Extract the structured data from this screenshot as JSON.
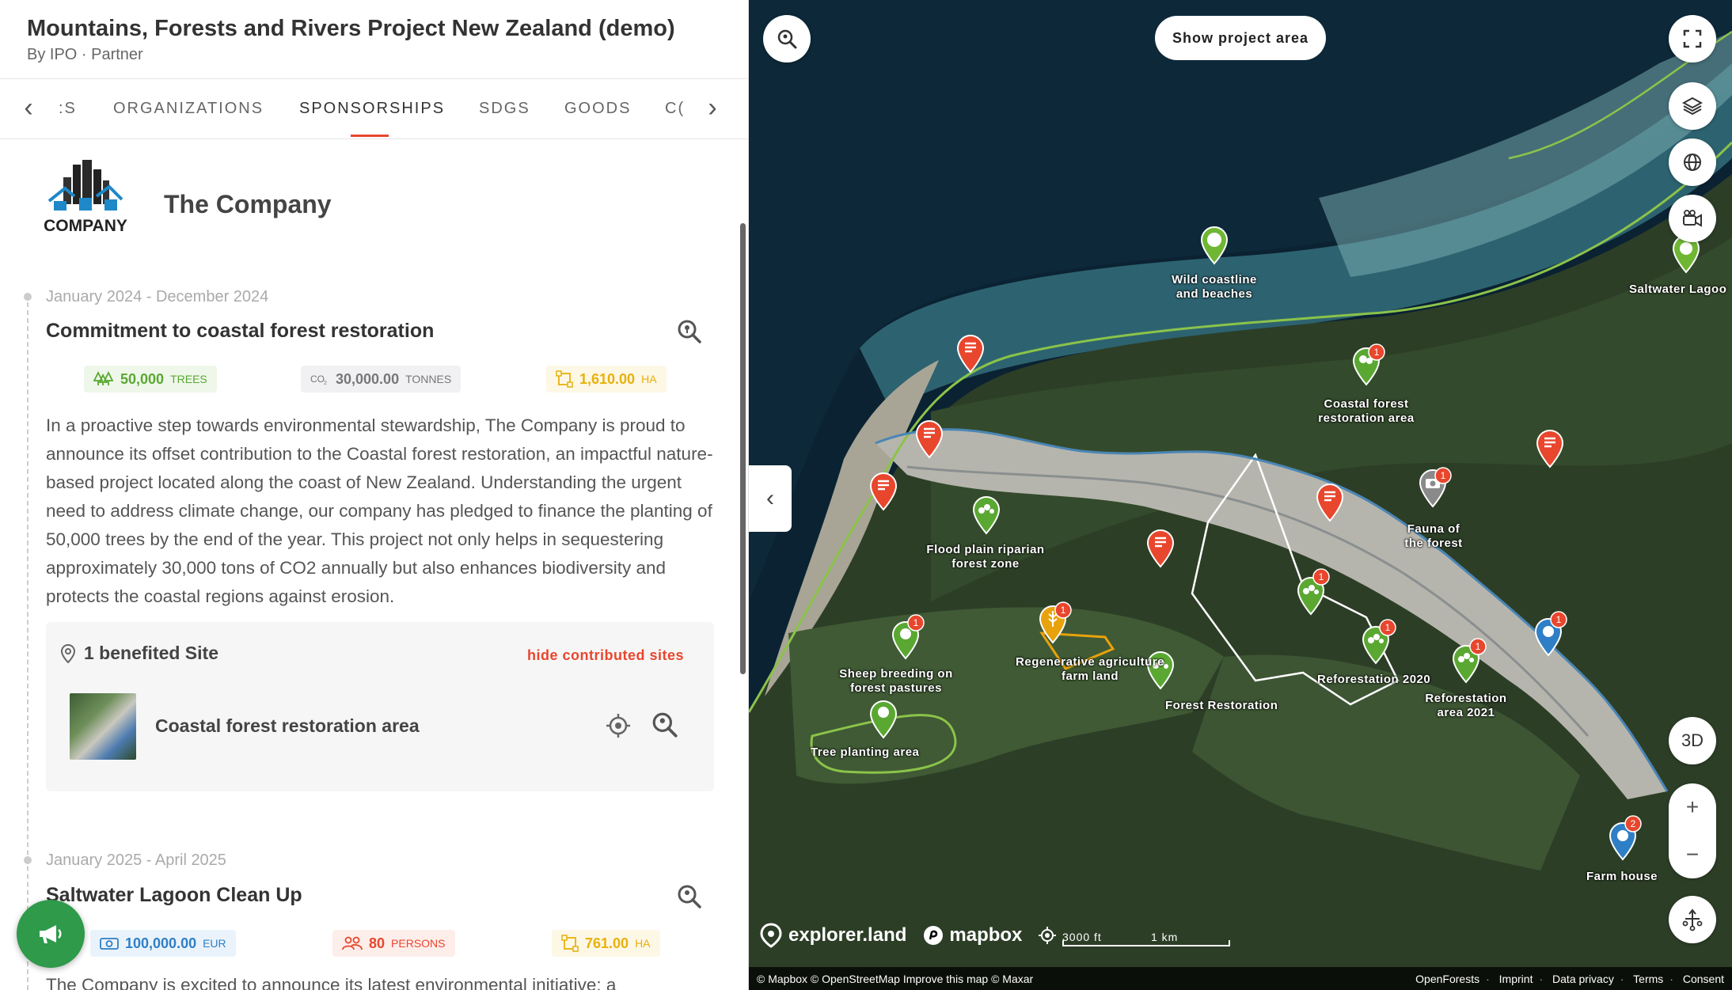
{
  "project": {
    "title": "Mountains, Forests and Rivers Project New Zealand (demo)",
    "subtitle": "By IPO · Partner"
  },
  "tabs": [
    {
      "label": ":S"
    },
    {
      "label": "ORGANIZATIONS"
    },
    {
      "label": "SPONSORSHIPS",
      "active": true
    },
    {
      "label": "SDGS"
    },
    {
      "label": "GOODS"
    },
    {
      "label": "C("
    }
  ],
  "sponsor": {
    "name": "The Company",
    "logo_text": "COMPANY"
  },
  "entries": [
    {
      "date": "January 2024 - December 2024",
      "title": "Commitment to coastal forest restoration",
      "stats": [
        {
          "value": "50,000",
          "unit": "TREES",
          "icon": "trees-icon",
          "color": "#5aa832"
        },
        {
          "value": "30,000.00",
          "unit": "TONNES",
          "icon": "co2-icon",
          "color": "#777777"
        },
        {
          "value": "1,610.00",
          "unit": "HA",
          "icon": "area-icon",
          "color": "#e8b10c"
        }
      ],
      "description": "In a proactive step towards environmental stewardship, The Company is proud to announce its offset contribution to the Coastal forest restoration, an impactful nature-based project located along the coast of New Zealand. Understanding the urgent need to address climate change, our company has pledged to finance the planting of 50,000 trees by the end of the year. This project not only helps in sequestering approximately 30,000 tons of CO2 annually but also enhances biodiversity and protects the coastal regions against erosion.",
      "sites_header": "1 benefited Site",
      "hide_link": "hide contributed sites",
      "site_name": "Coastal forest restoration area"
    },
    {
      "date": "January 2025 - April 2025",
      "title": "Saltwater Lagoon Clean Up",
      "stats": [
        {
          "value": "100,000.00",
          "unit": "EUR",
          "icon": "money-icon",
          "color": "#2f7fc6"
        },
        {
          "value": "80",
          "unit": "PERSONS",
          "icon": "persons-icon",
          "color": "#e8462d"
        },
        {
          "value": "761.00",
          "unit": "HA",
          "icon": "area-icon",
          "color": "#e8b10c"
        }
      ],
      "description": "The Company is excited to announce its latest environmental initiative: a"
    }
  ],
  "map": {
    "show_area_label": "Show project area",
    "btn_3d": "3D",
    "zoom_in": "+",
    "zoom_out": "−",
    "brand1": "explorer.land",
    "brand2": "mapbox",
    "scale_ft": "3000 ft",
    "scale_km": "1 km",
    "attribution_left": "© Mapbox © OpenStreetMap Improve this map © Maxar",
    "footer_links": [
      "OpenForests",
      "Imprint",
      "Data privacy",
      "Terms",
      "Consent"
    ],
    "labels": [
      {
        "text": "Wild coastline and beaches"
      },
      {
        "text": "Saltwater Lagoo"
      },
      {
        "text": "Coastal forest restoration area"
      },
      {
        "text": "Fauna of the forest"
      },
      {
        "text": "Flood plain riparian forest zone"
      },
      {
        "text": "Sheep breeding on forest pastures"
      },
      {
        "text": "Regenerative agriculture farm land"
      },
      {
        "text": "Forest Restoration"
      },
      {
        "text": "Reforestation 2020"
      },
      {
        "text": "Reforestation area 2021"
      },
      {
        "text": "Tree planting area"
      },
      {
        "text": "Farm house"
      }
    ],
    "marker_badges": [
      "1",
      "1",
      "1",
      "1",
      "1",
      "1",
      "1",
      "1",
      "2"
    ],
    "colors": {
      "accent": "#e8462d",
      "green_marker": "#5aa832",
      "yellow_marker": "#e8a20c",
      "blue_marker": "#2f7fc6",
      "gray_marker": "#888888"
    }
  }
}
